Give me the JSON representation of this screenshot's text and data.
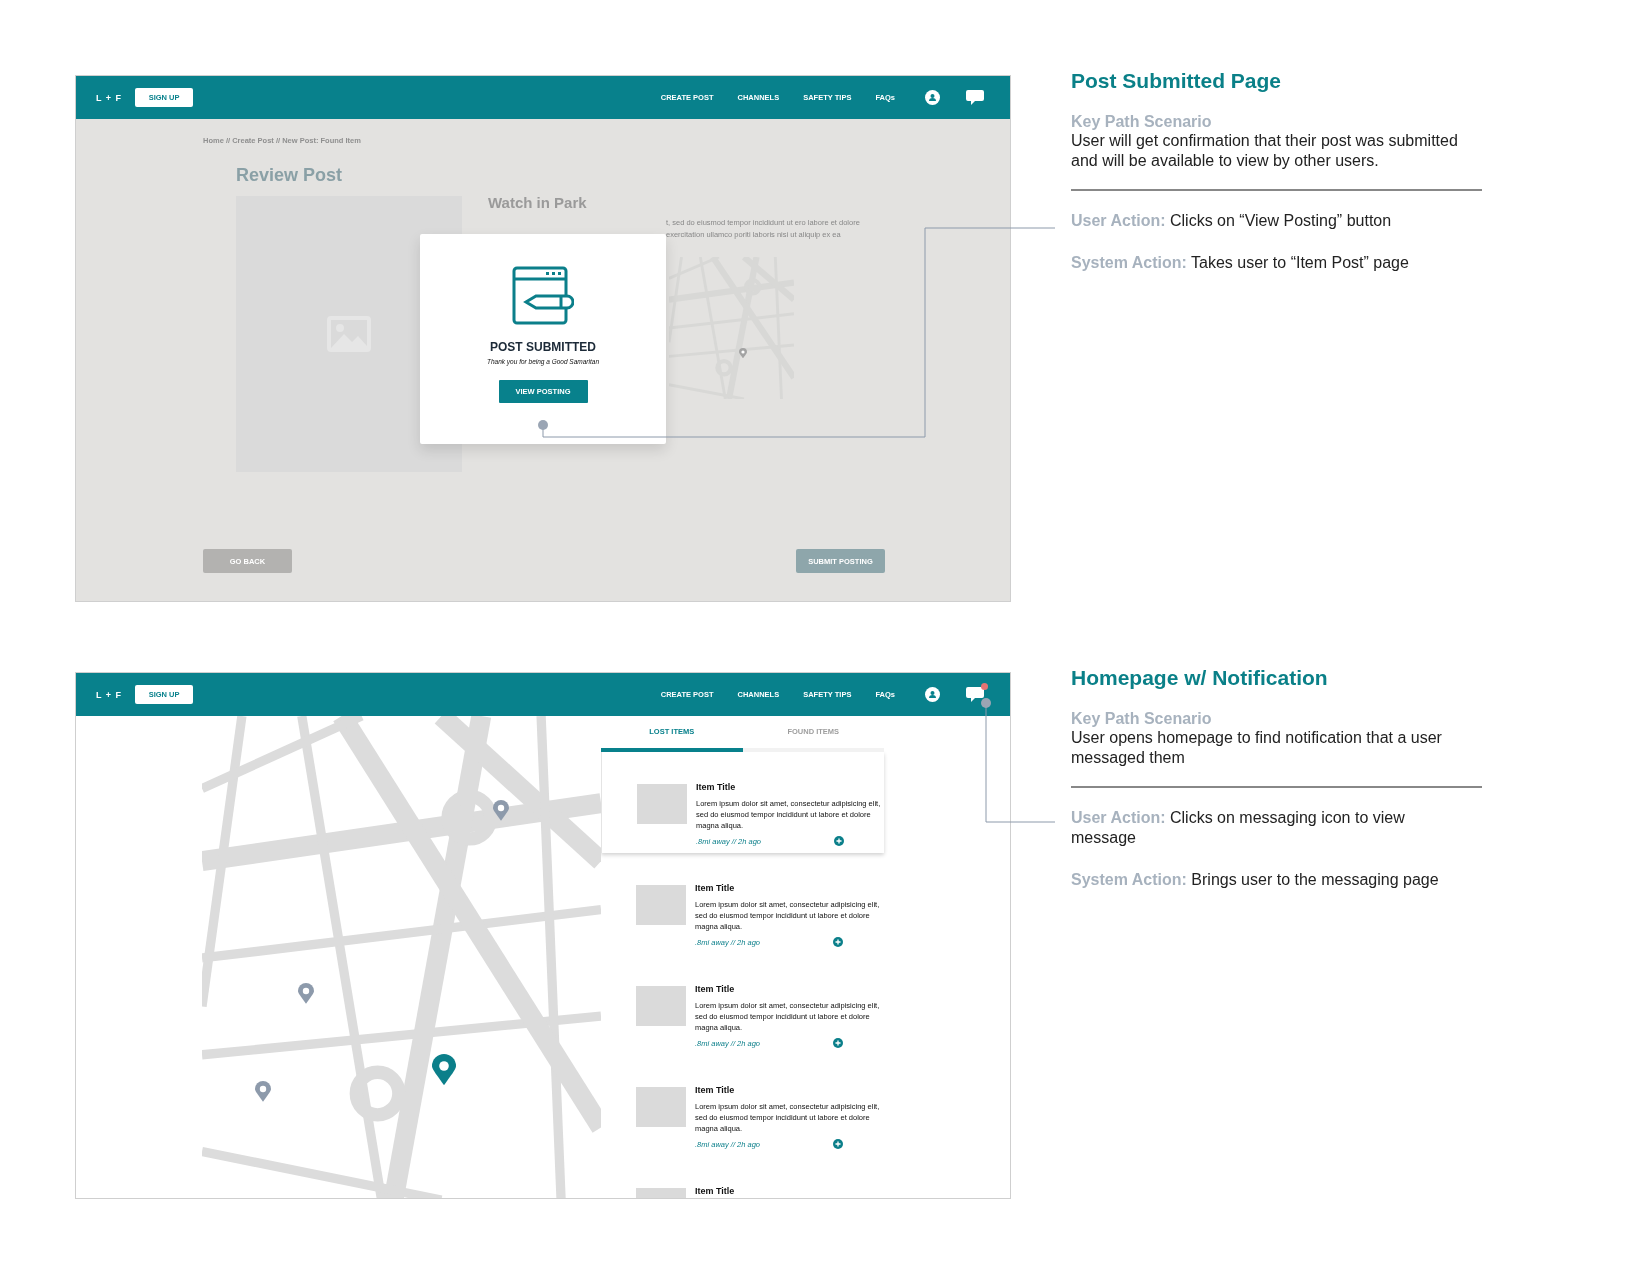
{
  "slides": [
    {
      "kind": "post_submitted",
      "nav": {
        "logo": "L + F",
        "signup": "SIGN UP",
        "links": [
          "CREATE POST",
          "CHANNELS",
          "SAFETY TIPS",
          "FAQs"
        ],
        "notification": false
      },
      "breadcrumb": "Home // Create Post // New Post: Found Item",
      "page_title": "Review Post",
      "item_title": "Watch in Park",
      "description_lines": [
        "t, sed do eiusmod tempor incididunt ut ero labore et dolore",
        "exercitation ullamco poriti laboris nisi ut aliquip ex ea"
      ],
      "buttons": [
        {
          "label": "GO BACK",
          "kind": "secondary"
        },
        {
          "label": "SUBMIT POSTING",
          "kind": "primary"
        }
      ],
      "modal": {
        "title": "POST SUBMITTED",
        "subtitle": "Thank you for being a Good Samaritan",
        "button": "VIEW POSTING"
      },
      "notes": {
        "heading": "Post Submitted Page",
        "scenario_label": "Key Path Scenario",
        "scenario": "User will get confirmation that their post was submitted and will be available to view by other users.",
        "user_action": "**User Action:** Clicks on “View Posting” button",
        "system_action": "**System Action:** Takes user to “Item Post” page"
      }
    },
    {
      "kind": "homepage",
      "nav": {
        "logo": "L + F",
        "signup": "SIGN UP",
        "links": [
          "CREATE POST",
          "CHANNELS",
          "SAFETY TIPS",
          "FAQs"
        ],
        "notification": true
      },
      "tabs": [
        {
          "label": "LOST ITEMS",
          "selected": true
        },
        {
          "label": "FOUND ITEMS",
          "selected": false
        }
      ],
      "items": [
        {
          "title": "Item Title",
          "description": "Lorem ipsum dolor sit amet, consectetur adipisicing elit, sed do eiusmod tempor incididunt ut labore et dolore magna aliqua.",
          "meta": ".8mi away // 2h ago",
          "highlighted": true
        },
        {
          "title": "Item Title",
          "description": "Lorem ipsum dolor sit amet, consectetur adipisicing elit, sed do eiusmod tempor incididunt ut labore et dolore magna aliqua.",
          "meta": ".8mi away // 2h ago",
          "highlighted": false
        },
        {
          "title": "Item Title",
          "description": "Lorem ipsum dolor sit amet, consectetur adipisicing elit, sed do eiusmod tempor incididunt ut labore et dolore magna aliqua.",
          "meta": ".8mi away // 2h ago",
          "highlighted": false
        },
        {
          "title": "Item Title",
          "description": "Lorem ipsum dolor sit amet, consectetur adipisicing elit, sed do eiusmod tempor incididunt ut labore et dolore magna aliqua.",
          "meta": ".8mi away // 2h ago",
          "highlighted": false
        },
        {
          "title": "Item Title",
          "highlighted": false
        }
      ],
      "notes": {
        "heading": "Homepage w/ Notification",
        "scenario_label": "Key Path Scenario",
        "scenario": "User opens homepage to find notification that a user messaged them",
        "user_action": "**User Action:** Clicks on messaging icon to view message",
        "system_action": "**System Action:** Brings user to the messaging page"
      }
    }
  ]
}
